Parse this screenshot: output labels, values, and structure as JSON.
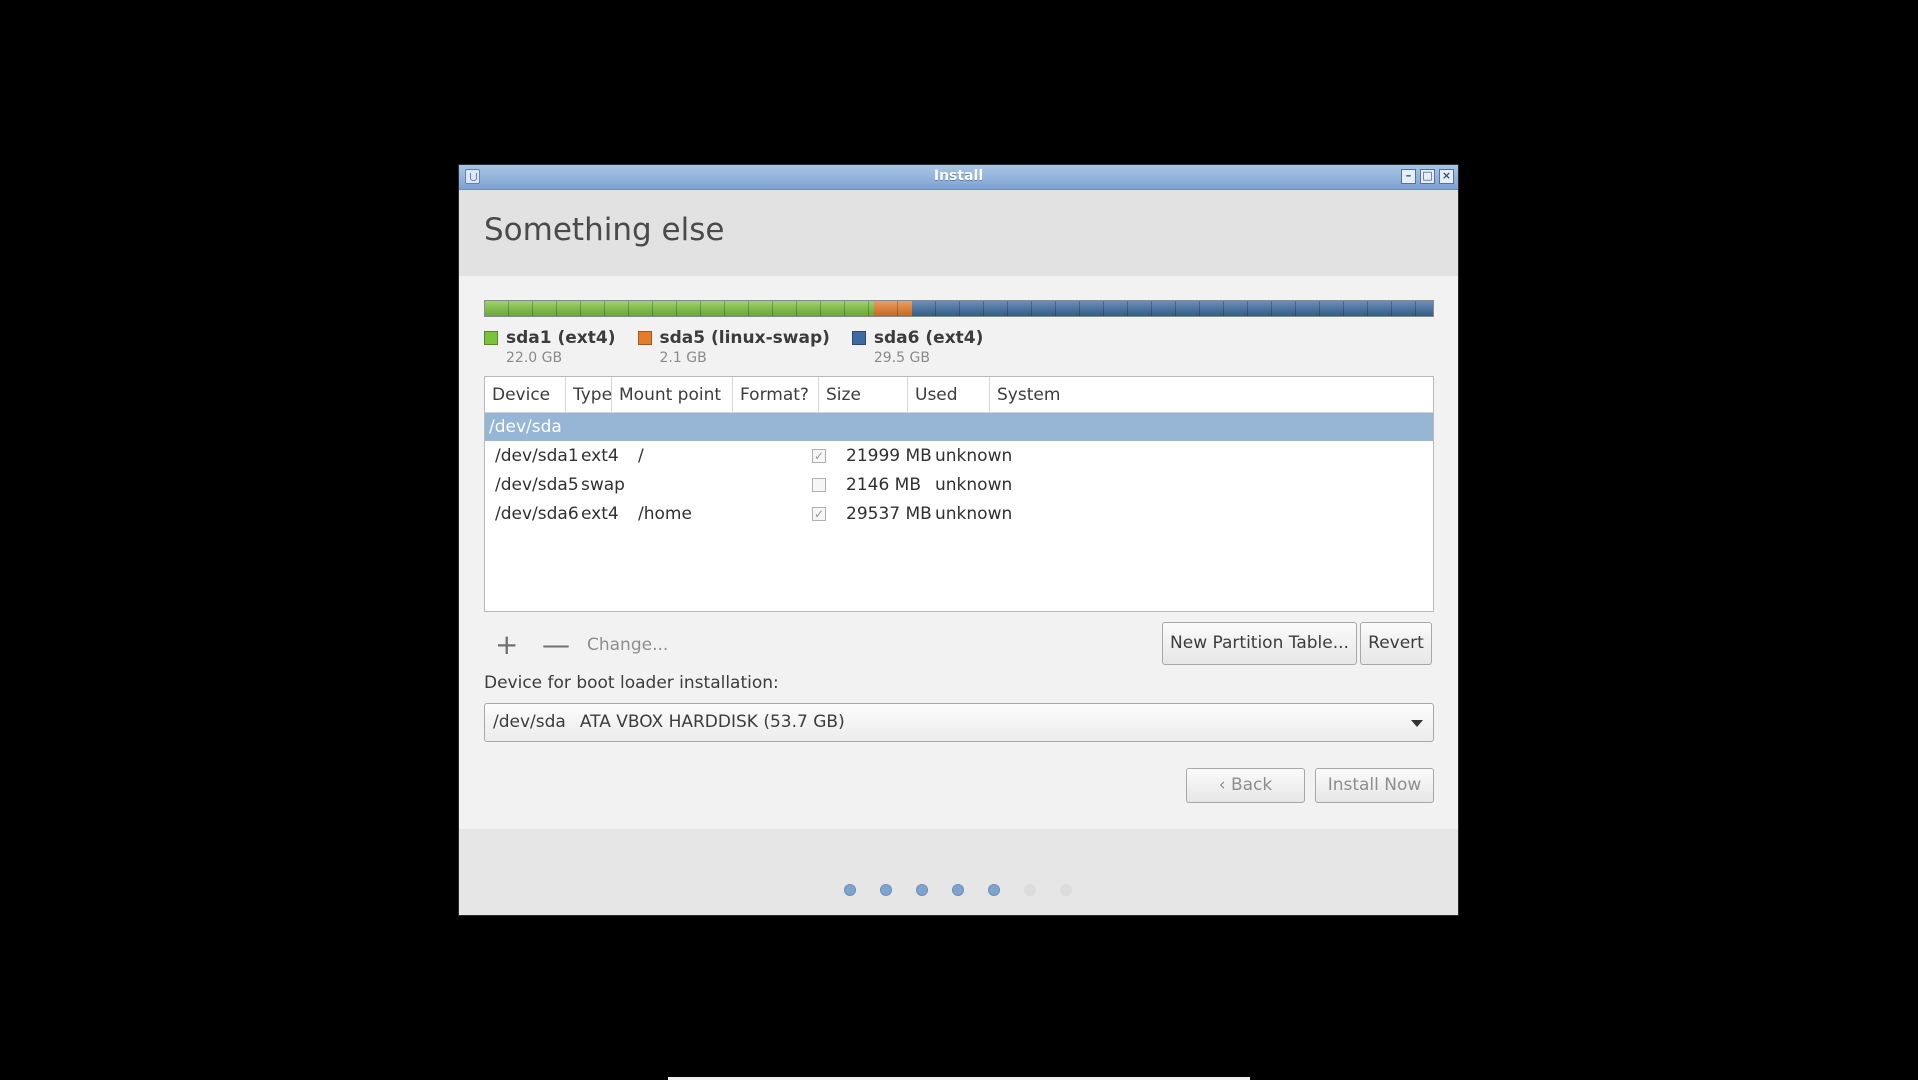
{
  "window": {
    "title": "Install",
    "minimize": "–",
    "maximize": "□",
    "close": "×"
  },
  "header": {
    "title": "Something else"
  },
  "disk": {
    "segments": [
      {
        "name": "sda1 (ext4)",
        "size": "22.0 GB",
        "color": "#7cc33d",
        "fraction": 0.41
      },
      {
        "name": "sda5 (linux-swap)",
        "size": "2.1 GB",
        "color": "#e57c2a",
        "fraction": 0.04
      },
      {
        "name": "sda6 (ext4)",
        "size": "29.5 GB",
        "color": "#3d6aa0",
        "fraction": 0.55
      }
    ]
  },
  "table": {
    "headers": [
      "Device",
      "Type",
      "Mount point",
      "Format?",
      "Size",
      "Used",
      "System"
    ],
    "disk_row": "/dev/sda",
    "rows": [
      {
        "device": "/dev/sda1",
        "type": "ext4",
        "mount": "/",
        "format": true,
        "size": "21999 MB",
        "used": "unknown",
        "system": ""
      },
      {
        "device": "/dev/sda5",
        "type": "swap",
        "mount": "",
        "format": false,
        "size": "2146 MB",
        "used": "unknown",
        "system": ""
      },
      {
        "device": "/dev/sda6",
        "type": "ext4",
        "mount": "/home",
        "format": true,
        "size": "29537 MB",
        "used": "unknown",
        "system": ""
      }
    ]
  },
  "toolbar": {
    "add": "+",
    "remove": "—",
    "change": "Change...",
    "new_table": "New Partition Table...",
    "revert": "Revert"
  },
  "bootloader": {
    "label": "Device for boot loader installation:",
    "device": "/dev/sda",
    "description": "ATA VBOX HARDDISK (53.7 GB)"
  },
  "nav": {
    "back": "Back",
    "back_icon": "chevron-left-icon",
    "install": "Install Now"
  },
  "progress": {
    "total_steps": 7,
    "completed_steps": 5,
    "accent": "#7fa3cf"
  }
}
